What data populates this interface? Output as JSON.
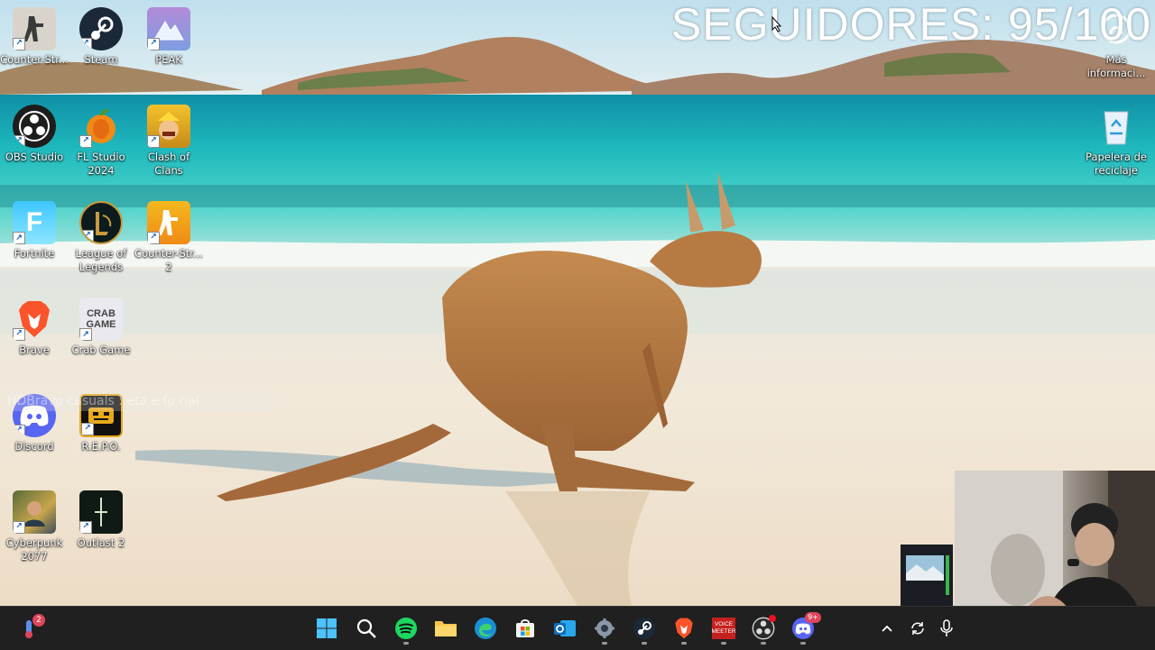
{
  "overlay": {
    "followers_text": "SEGUIDORES: 95/100",
    "chat_text": "HDBravo casuals : eta e fo rial"
  },
  "desktop": {
    "icons": [
      {
        "label": "Counter-Str...",
        "icon": "counter-strike-icon"
      },
      {
        "label": "Steam",
        "icon": "steam-icon"
      },
      {
        "label": "PEAK",
        "icon": "peak-icon"
      },
      {
        "label": "OBS Studio",
        "icon": "obs-icon"
      },
      {
        "label": "FL Studio 2024",
        "icon": "fl-studio-icon"
      },
      {
        "label": "Clash of Clans",
        "icon": "clash-of-clans-icon"
      },
      {
        "label": "Fortnite",
        "icon": "fortnite-icon"
      },
      {
        "label": "League of Legends",
        "icon": "league-of-legends-icon"
      },
      {
        "label": "Counter-Str... 2",
        "icon": "counter-strike-2-icon"
      },
      {
        "label": "Brave",
        "icon": "brave-icon"
      },
      {
        "label": "Crab Game",
        "icon": "crab-game-icon"
      },
      {
        "label": "Discord",
        "icon": "discord-icon"
      },
      {
        "label": "R.E.P.O.",
        "icon": "repo-icon"
      },
      {
        "label": "Cyberpunk 2077",
        "icon": "cyberpunk-icon"
      },
      {
        "label": "Outlast 2",
        "icon": "outlast-icon"
      },
      {
        "label": "Más informaci...",
        "icon": "info-icon"
      },
      {
        "label": "Papelera de reciclaje",
        "icon": "recycle-bin-icon"
      }
    ],
    "crab_game_logo_text": "CRAB GAME",
    "fortnite_logo_text": "F"
  },
  "taskbar": {
    "widgets_badge": "2",
    "discord_badge": "9+",
    "voicemeeter_text": "VOICE MEETER",
    "apps": [
      "start-icon",
      "search-icon",
      "spotify-icon",
      "file-explorer-icon",
      "edge-icon",
      "store-icon",
      "outlook-icon",
      "settings-icon",
      "steam-icon",
      "brave-icon",
      "voicemeeter-icon",
      "obs-icon",
      "discord-icon"
    ],
    "tray": [
      "chevron-up-icon",
      "sync-icon",
      "microphone-icon"
    ]
  },
  "colors": {
    "taskbar_bg": "#202020",
    "sky": "#cfe7f2",
    "sea": "#2cc7c4",
    "sand": "#efe4d2"
  }
}
